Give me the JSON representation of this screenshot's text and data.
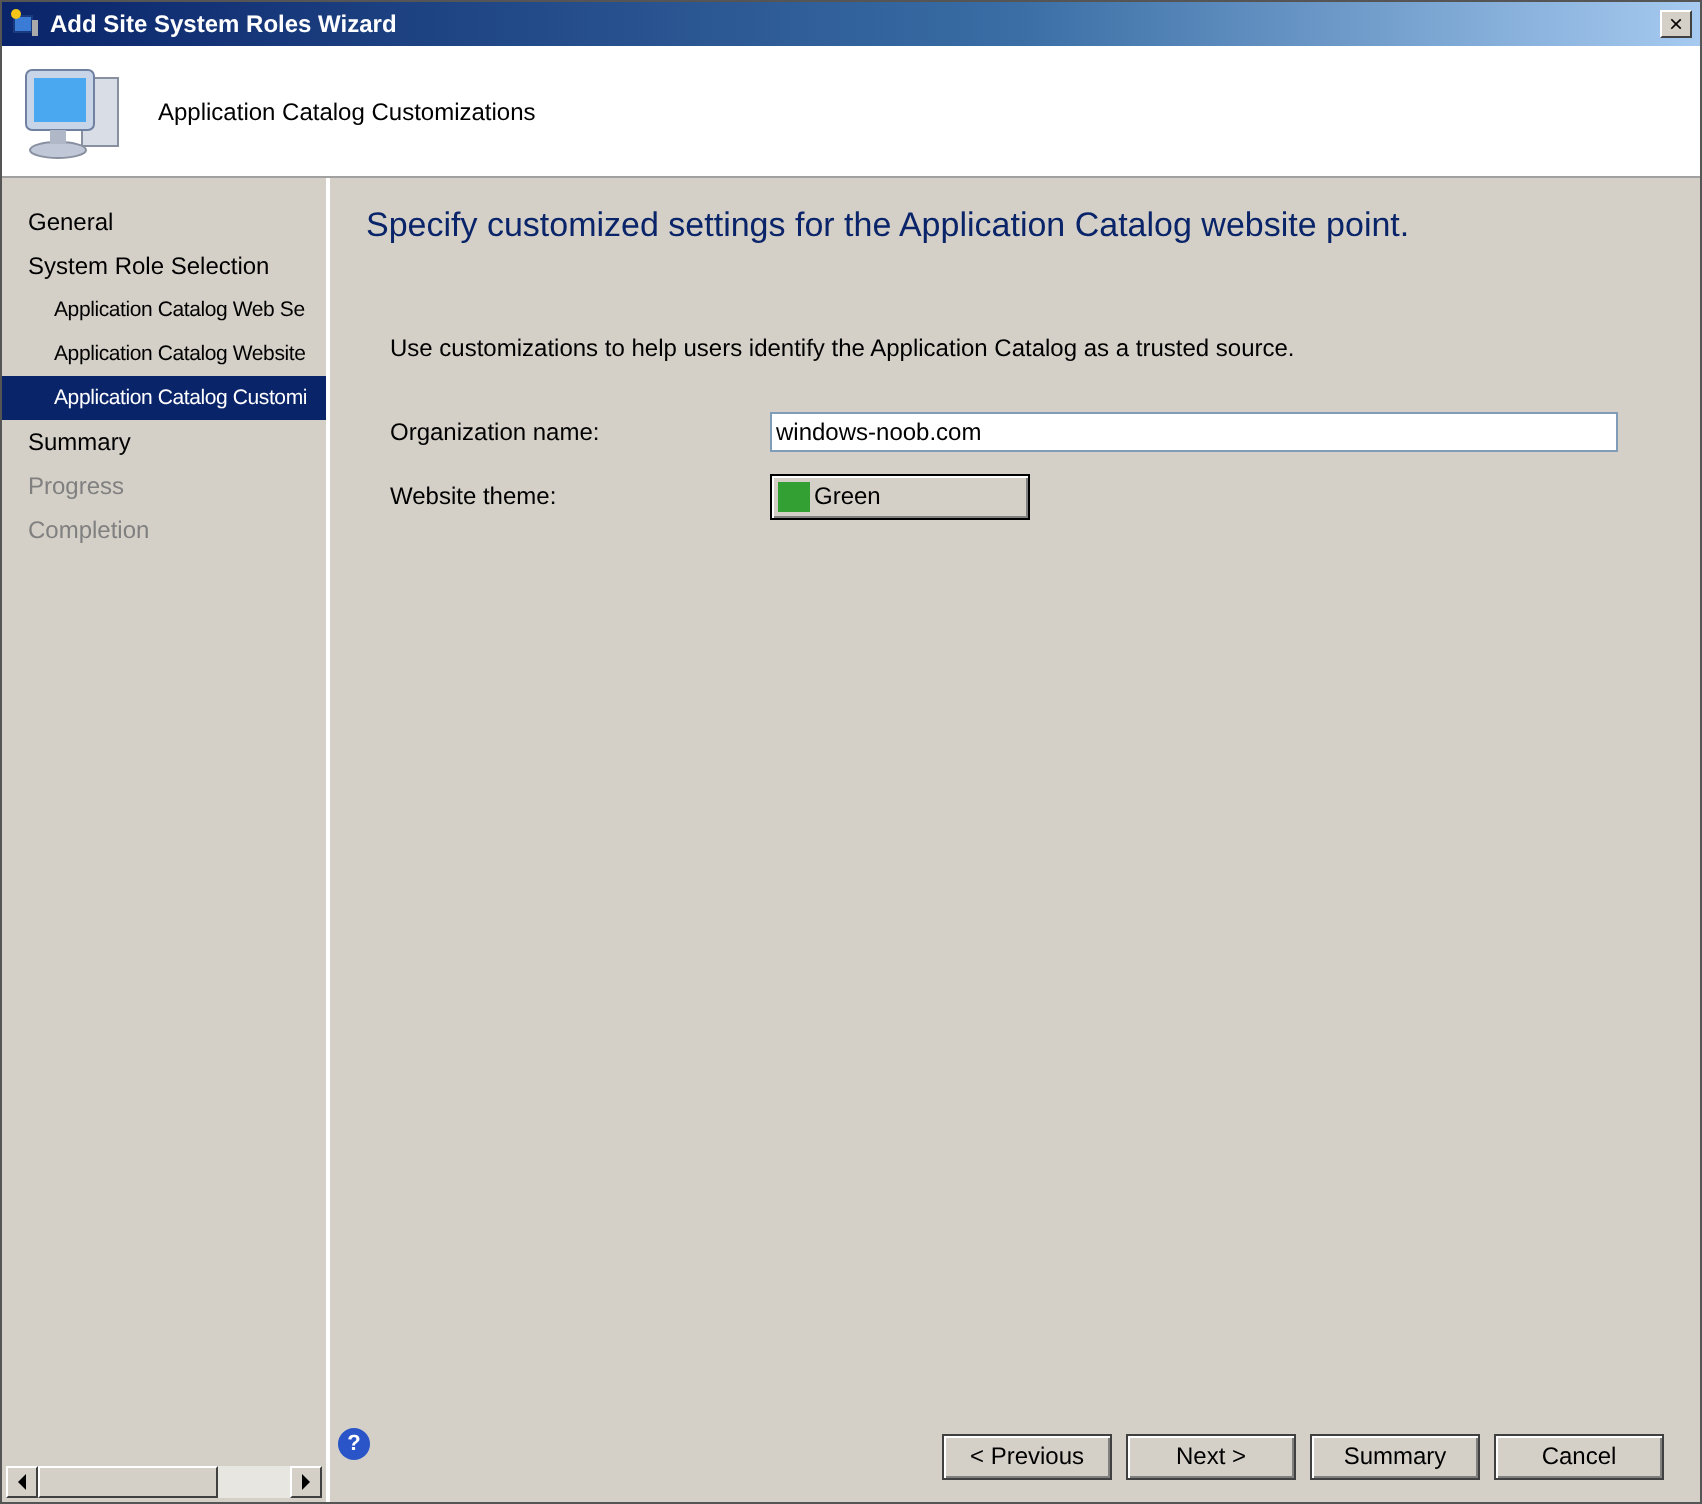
{
  "window": {
    "title": "Add Site System Roles Wizard",
    "close": "×"
  },
  "header": {
    "title": "Application Catalog Customizations"
  },
  "sidebar": {
    "items": [
      {
        "label": "General",
        "selected": false,
        "disabled": false
      },
      {
        "label": "System Role Selection",
        "selected": false,
        "disabled": false,
        "children": [
          {
            "label": "Application Catalog Web Se",
            "selected": false,
            "disabled": false
          },
          {
            "label": "Application Catalog Website",
            "selected": false,
            "disabled": false
          },
          {
            "label": "Application Catalog Customi",
            "selected": true,
            "disabled": false
          }
        ]
      },
      {
        "label": "Summary",
        "selected": false,
        "disabled": false
      },
      {
        "label": "Progress",
        "selected": false,
        "disabled": true
      },
      {
        "label": "Completion",
        "selected": false,
        "disabled": true
      }
    ]
  },
  "content": {
    "heading": "Specify customized settings for the Application Catalog website point.",
    "description": "Use customizations to help users identify the Application Catalog as a trusted source.",
    "organization": {
      "label": "Organization name:",
      "value": "windows-noob.com"
    },
    "theme": {
      "label": "Website theme:",
      "value": "Green",
      "color": "#33a033"
    }
  },
  "help": "?",
  "buttons": [
    "< Previous",
    "Next >",
    "Summary",
    "Cancel"
  ]
}
